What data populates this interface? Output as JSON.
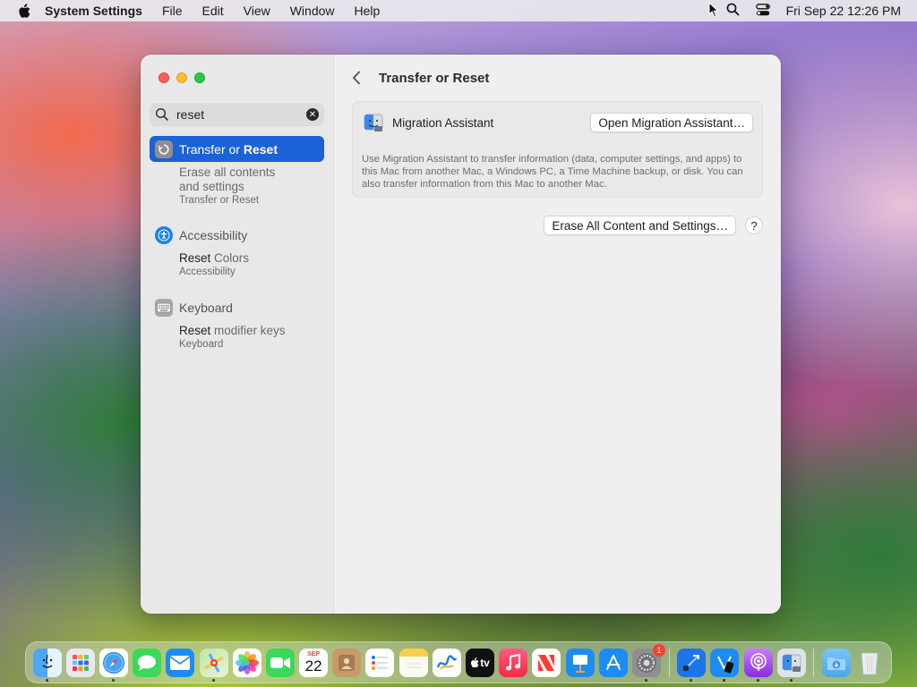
{
  "menubar": {
    "app_name": "System Settings",
    "items": [
      "File",
      "Edit",
      "View",
      "Window",
      "Help"
    ],
    "clock": "Fri Sep 22  12:26 PM"
  },
  "search": {
    "value": "reset"
  },
  "sidebar": {
    "results": [
      {
        "title_plain": "Transfer or ",
        "title_bold": "Reset",
        "selected": true,
        "icon": "transfer-reset-icon",
        "subs": [
          {
            "line1": "Erase all contents",
            "line2": "and settings",
            "location": "Transfer or Reset"
          }
        ]
      },
      {
        "title_plain": "Accessibility",
        "title_bold": "",
        "selected": false,
        "icon": "accessibility-icon",
        "subs": [
          {
            "bold": "Reset",
            "rest": " Colors",
            "location": "Accessibility"
          }
        ]
      },
      {
        "title_plain": "Keyboard",
        "title_bold": "",
        "selected": false,
        "icon": "keyboard-icon",
        "subs": [
          {
            "bold": "Reset",
            "rest": " modifier keys",
            "location": "Keyboard"
          }
        ]
      }
    ]
  },
  "main": {
    "title": "Transfer or Reset",
    "migration": {
      "label": "Migration Assistant",
      "button": "Open Migration Assistant…",
      "description": "Use Migration Assistant to transfer information (data, computer settings, and apps) to this Mac from another Mac, a Windows PC, a Time Machine backup, or disk. You can also transfer information from this Mac to another Mac."
    },
    "erase_button": "Erase All Content and Settings…",
    "help": "?"
  },
  "dock": {
    "calendar_month": "SEP",
    "calendar_day": "22",
    "settings_badge": "1",
    "tv_label": "tv",
    "apps": [
      "finder",
      "launchpad",
      "safari",
      "messages",
      "mail",
      "maps",
      "photos",
      "facetime",
      "calendar",
      "contacts",
      "reminders",
      "notes",
      "freeform",
      "tv",
      "music",
      "news",
      "keynote",
      "app-store",
      "system-settings",
      "xcode",
      "simulator",
      "podcasts",
      "migration-assistant"
    ]
  }
}
